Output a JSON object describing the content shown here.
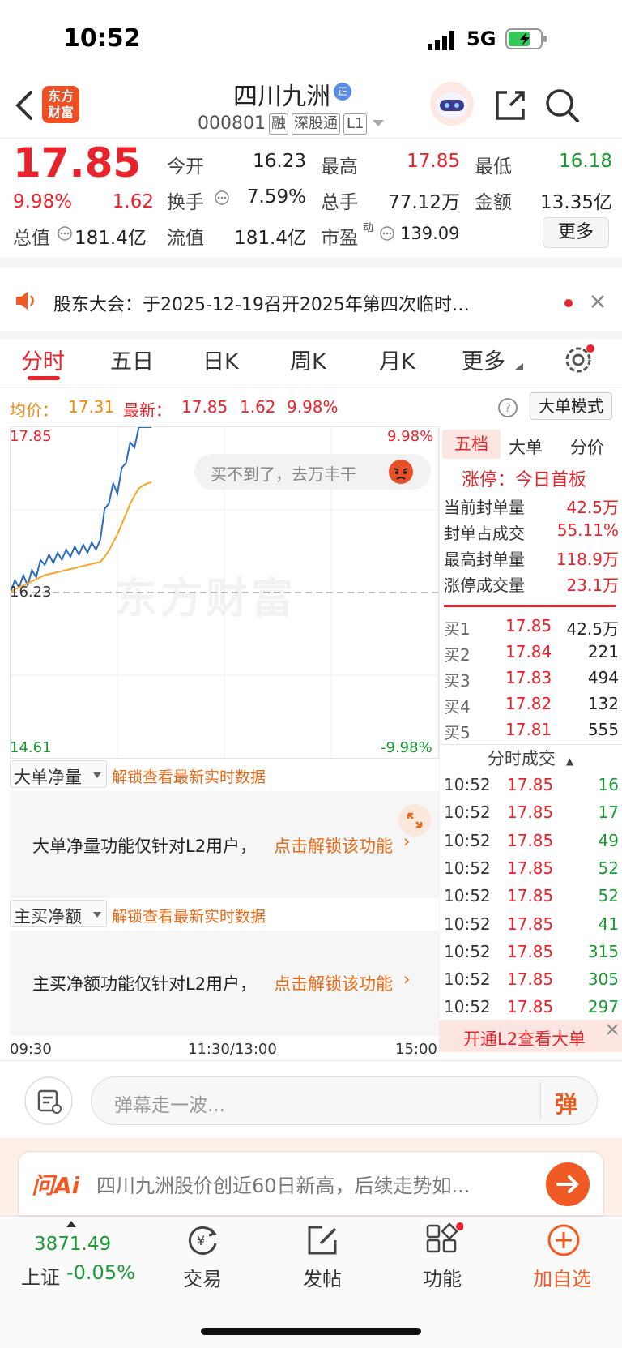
{
  "status": {
    "time": "10:52",
    "network": "5G"
  },
  "header": {
    "name": "四川九洲",
    "code": "000801",
    "tags": [
      "融",
      "深股通",
      "L1"
    ],
    "logo_line1": "东方",
    "logo_line2": "财富",
    "badge": "正"
  },
  "quote": {
    "price": "17.85",
    "pct": "9.98%",
    "chg": "1.62",
    "stats": [
      {
        "label": "今开",
        "value": "16.23",
        "color": "#222"
      },
      {
        "label": "最高",
        "value": "17.85",
        "color": "#e8232b"
      },
      {
        "label": "最低",
        "value": "16.18",
        "color": "#1a9a32"
      },
      {
        "label": "换手",
        "value": "7.59%",
        "color": "#222"
      },
      {
        "label": "总手",
        "value": "77.12万",
        "color": "#222"
      },
      {
        "label": "金额",
        "value": "13.35亿",
        "color": "#222"
      },
      {
        "label": "总值",
        "value": "181.4亿",
        "color": "#222"
      },
      {
        "label": "流值",
        "value": "181.4亿",
        "color": "#222"
      },
      {
        "label": "市盈",
        "value": "139.09",
        "color": "#222",
        "sup": "动"
      }
    ],
    "more": "更多"
  },
  "notice": {
    "text": "股东大会：于2025-12-19召开2025年第四次临时…"
  },
  "tabs": [
    "分时",
    "五日",
    "日K",
    "周K",
    "月K",
    "更多"
  ],
  "info_line": {
    "avg_label": "均价：",
    "avg": "17.31",
    "latest_label": "最新：",
    "latest": "17.85",
    "chg": "1.62",
    "pct": "9.98%",
    "mode_btn": "大单模式"
  },
  "chart_data": {
    "type": "line",
    "title": "",
    "y_top_label": "17.85",
    "y_mid_label": "16.23",
    "y_bottom_label": "14.61",
    "pct_top": "9.98%",
    "pct_bottom": "-9.98%",
    "x_labels": [
      "09:30",
      "11:30/13:00",
      "15:00"
    ],
    "ylim": [
      14.61,
      17.85
    ],
    "watermark": "东方财富",
    "series": [
      {
        "color": "#2b6cc4",
        "values": [
          16.23,
          16.35,
          16.28,
          16.4,
          16.3,
          16.45,
          16.38,
          16.55,
          16.5,
          16.6,
          16.52,
          16.62,
          16.55,
          16.65,
          16.58,
          16.68,
          16.6,
          16.7,
          16.62,
          16.72,
          16.65,
          16.75,
          17.05,
          17.1,
          17.3,
          17.2,
          17.45,
          17.5,
          17.7,
          17.65,
          17.85,
          17.85,
          17.85,
          17.85
        ]
      },
      {
        "color": "#f5a623",
        "values": [
          16.23,
          16.26,
          16.28,
          16.3,
          16.32,
          16.34,
          16.36,
          16.38,
          16.4,
          16.41,
          16.42,
          16.43,
          16.44,
          16.45,
          16.46,
          16.47,
          16.48,
          16.49,
          16.5,
          16.51,
          16.52,
          16.53,
          16.58,
          16.64,
          16.72,
          16.8,
          16.9,
          17.0,
          17.1,
          17.18,
          17.25,
          17.28,
          17.3,
          17.31
        ]
      }
    ],
    "bubble": "买不到了，去万丰干"
  },
  "order_book": {
    "tabs": [
      "五档",
      "大单",
      "分价"
    ],
    "limit_title": "涨停：今日首板",
    "limit_rows": [
      {
        "label": "当前封单量",
        "value": "42.5万"
      },
      {
        "label": "封单占成交",
        "value": "55.11%"
      },
      {
        "label": "最高封单量",
        "value": "118.9万"
      },
      {
        "label": "涨停成交量",
        "value": "23.1万"
      }
    ],
    "bids": [
      {
        "label": "买1",
        "price": "17.85",
        "vol": "42.5万"
      },
      {
        "label": "买2",
        "price": "17.84",
        "vol": "221"
      },
      {
        "label": "买3",
        "price": "17.83",
        "vol": "494"
      },
      {
        "label": "买4",
        "price": "17.82",
        "vol": "132"
      },
      {
        "label": "买5",
        "price": "17.81",
        "vol": "555"
      }
    ]
  },
  "trades": {
    "title": "分时成交",
    "rows": [
      {
        "t": "10:52",
        "p": "17.85",
        "v": "16"
      },
      {
        "t": "10:52",
        "p": "17.85",
        "v": "17"
      },
      {
        "t": "10:52",
        "p": "17.85",
        "v": "49"
      },
      {
        "t": "10:52",
        "p": "17.85",
        "v": "52"
      },
      {
        "t": "10:52",
        "p": "17.85",
        "v": "52"
      },
      {
        "t": "10:52",
        "p": "17.85",
        "v": "41"
      },
      {
        "t": "10:52",
        "p": "17.85",
        "v": "315"
      },
      {
        "t": "10:52",
        "p": "17.85",
        "v": "305"
      },
      {
        "t": "10:52",
        "p": "17.85",
        "v": "297"
      }
    ],
    "l2_banner": "开通L2查看大单"
  },
  "panels": [
    {
      "dropdown": "大单净量",
      "hint": "解锁查看最新实时数据",
      "msg": "大单净量功能仅针对L2用户，",
      "link": "点击解锁该功能"
    },
    {
      "dropdown": "主买净额",
      "hint": "解锁查看最新实时数据",
      "msg": "主买净额功能仅针对L2用户，",
      "link": "点击解锁该功能"
    }
  ],
  "danmu": {
    "placeholder": "弹幕走一波...",
    "btn": "弹"
  },
  "ai": {
    "logo": "问Ai",
    "text": "四川九洲股价创近60日新高，后续走势如..."
  },
  "bottom_nav": {
    "index_value": "3871.49",
    "index_name": "上证",
    "index_pct": "-0.05%",
    "items": [
      "交易",
      "发帖",
      "功能",
      "加自选"
    ]
  }
}
